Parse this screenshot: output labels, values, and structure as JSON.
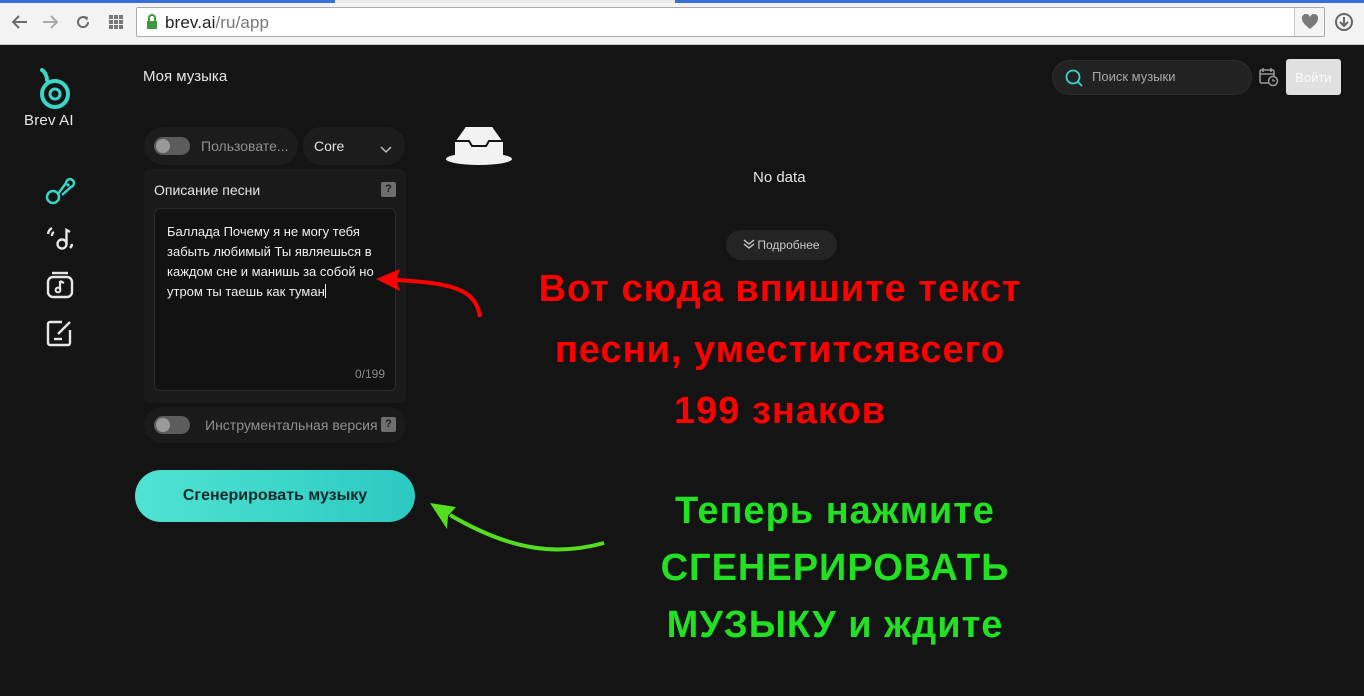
{
  "browser": {
    "url_host": "brev.ai",
    "url_path": "/ru/app"
  },
  "app": {
    "logo_text": "Brev AI",
    "page_title": "Моя музыка",
    "search_placeholder": "Поиск музыки",
    "login_label": "Войти",
    "sidebar_icons": [
      "music-note-icon",
      "radio-music-icon",
      "music-library-icon",
      "edit-note-icon"
    ],
    "accent_color": "#3ad6c8"
  },
  "form": {
    "custom_mode_label": "Пользовате...",
    "model_select": "Core",
    "description_label": "Описание песни",
    "description_text": "Баллада Почему я не могу тебя забыть любимый Ты являешься в каждом сне и манишь за собой но утром ты таешь как туман",
    "char_counter": "0/199",
    "instrumental_label": "Инструментальная версия",
    "help_mark": "?",
    "generate_label": "Сгенерировать музыку"
  },
  "main": {
    "empty_text": "No data",
    "more_label": "Подробнее"
  },
  "annotations": {
    "red_lines": [
      "Вот сюда впишите текст",
      "песни, уместитсявсего",
      "199 знаков"
    ],
    "green_lines": [
      "Теперь нажмите",
      "СГЕНЕРИРОВАТЬ",
      "МУЗЫКУ и ждите"
    ],
    "red_color": "#ff0000",
    "green_color": "#22e022"
  }
}
